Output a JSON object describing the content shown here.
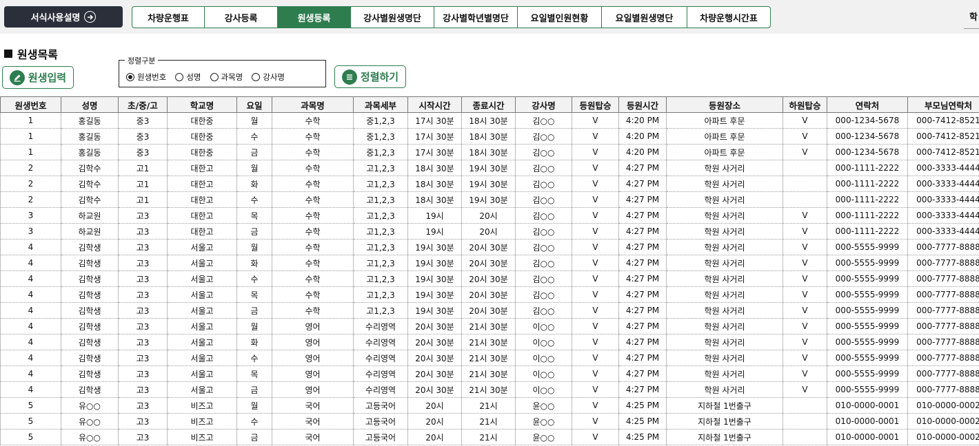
{
  "topbar": {
    "guide_label": "서식사용설명",
    "tabs": [
      {
        "label": "차량운행표",
        "width": 105
      },
      {
        "label": "강사등록",
        "width": 106
      },
      {
        "label": "원생등록",
        "width": 106,
        "active": true
      },
      {
        "label": "강사별원생명단",
        "width": 121
      },
      {
        "label": "강사별학년별명단",
        "width": 121
      },
      {
        "label": "요일별인원현황",
        "width": 122
      },
      {
        "label": "요일별원생명단",
        "width": 124
      },
      {
        "label": "차량운행시간표",
        "width": 120
      }
    ],
    "right_label": "학"
  },
  "section": {
    "title": "원생목록"
  },
  "buttons": {
    "add_label": "원생입력",
    "sort_label": "정렬하기"
  },
  "sort_group": {
    "legend": "정렬구분",
    "options": [
      {
        "label": "원생번호",
        "selected": true
      },
      {
        "label": "성명",
        "selected": false
      },
      {
        "label": "과목명",
        "selected": false
      },
      {
        "label": "강사명",
        "selected": false
      }
    ]
  },
  "table": {
    "columns": [
      {
        "label": "원생번호",
        "width": 88
      },
      {
        "label": "성명",
        "width": 83
      },
      {
        "label": "초/중/고",
        "width": 71
      },
      {
        "label": "학교명",
        "width": 101
      },
      {
        "label": "요일",
        "width": 51
      },
      {
        "label": "과목명",
        "width": 118
      },
      {
        "label": "과목세부",
        "width": 79
      },
      {
        "label": "시작시간",
        "width": 78
      },
      {
        "label": "종료시간",
        "width": 78
      },
      {
        "label": "강사명",
        "width": 82
      },
      {
        "label": "등원탑승",
        "width": 68
      },
      {
        "label": "등원시간",
        "width": 69
      },
      {
        "label": "등원장소",
        "width": 169
      },
      {
        "label": "하원탑승",
        "width": 64
      },
      {
        "label": "연락처",
        "width": 117
      },
      {
        "label": "부모님연락처",
        "width": 118
      }
    ],
    "rows": [
      [
        "1",
        "홍길동",
        "중3",
        "대한중",
        "월",
        "수학",
        "중1,2,3",
        "17시 30분",
        "18시 30분",
        "김○○",
        "V",
        "4:20 PM",
        "아파트 후문",
        "V",
        "000-1234-5678",
        "000-7412-8521"
      ],
      [
        "1",
        "홍길동",
        "중3",
        "대한중",
        "수",
        "수학",
        "중1,2,3",
        "17시 30분",
        "18시 30분",
        "김○○",
        "V",
        "4:20 PM",
        "아파트 후문",
        "V",
        "000-1234-5678",
        "000-7412-8521"
      ],
      [
        "1",
        "홍길동",
        "중3",
        "대한중",
        "금",
        "수학",
        "중1,2,3",
        "17시 30분",
        "18시 30분",
        "김○○",
        "V",
        "4:20 PM",
        "아파트 후문",
        "V",
        "000-1234-5678",
        "000-7412-8521"
      ],
      [
        "2",
        "김학수",
        "고1",
        "대한고",
        "월",
        "수학",
        "고1,2,3",
        "18시 30분",
        "19시 30분",
        "김○○",
        "V",
        "4:27 PM",
        "학원 사거리",
        "",
        "000-1111-2222",
        "000-3333-4444"
      ],
      [
        "2",
        "김학수",
        "고1",
        "대한고",
        "화",
        "수학",
        "고1,2,3",
        "18시 30분",
        "19시 30분",
        "김○○",
        "V",
        "4:27 PM",
        "학원 사거리",
        "",
        "000-1111-2222",
        "000-3333-4444"
      ],
      [
        "2",
        "김학수",
        "고1",
        "대한고",
        "수",
        "수학",
        "고1,2,3",
        "18시 30분",
        "19시 30분",
        "김○○",
        "V",
        "4:27 PM",
        "학원 사거리",
        "",
        "000-1111-2222",
        "000-3333-4444"
      ],
      [
        "3",
        "하교원",
        "고3",
        "대한고",
        "목",
        "수학",
        "고1,2,3",
        "19시",
        "20시",
        "김○○",
        "V",
        "4:27 PM",
        "학원 사거리",
        "V",
        "000-1111-2222",
        "000-3333-4444"
      ],
      [
        "3",
        "하교원",
        "고3",
        "대한고",
        "금",
        "수학",
        "고1,2,3",
        "19시",
        "20시",
        "김○○",
        "V",
        "4:27 PM",
        "학원 사거리",
        "V",
        "000-1111-2222",
        "000-3333-4444"
      ],
      [
        "4",
        "김학생",
        "고3",
        "서울고",
        "월",
        "수학",
        "고1,2,3",
        "19시 30분",
        "20시 30분",
        "김○○",
        "V",
        "4:27 PM",
        "학원 사거리",
        "V",
        "000-5555-9999",
        "000-7777-8888"
      ],
      [
        "4",
        "김학생",
        "고3",
        "서울고",
        "화",
        "수학",
        "고1,2,3",
        "19시 30분",
        "20시 30분",
        "김○○",
        "V",
        "4:27 PM",
        "학원 사거리",
        "V",
        "000-5555-9999",
        "000-7777-8888"
      ],
      [
        "4",
        "김학생",
        "고3",
        "서울고",
        "수",
        "수학",
        "고1,2,3",
        "19시 30분",
        "20시 30분",
        "김○○",
        "V",
        "4:27 PM",
        "학원 사거리",
        "V",
        "000-5555-9999",
        "000-7777-8888"
      ],
      [
        "4",
        "김학생",
        "고3",
        "서울고",
        "목",
        "수학",
        "고1,2,3",
        "19시 30분",
        "20시 30분",
        "김○○",
        "V",
        "4:27 PM",
        "학원 사거리",
        "V",
        "000-5555-9999",
        "000-7777-8888"
      ],
      [
        "4",
        "김학생",
        "고3",
        "서울고",
        "금",
        "수학",
        "고1,2,3",
        "19시 30분",
        "20시 30분",
        "김○○",
        "V",
        "4:27 PM",
        "학원 사거리",
        "V",
        "000-5555-9999",
        "000-7777-8888"
      ],
      [
        "4",
        "김학생",
        "고3",
        "서울고",
        "월",
        "영어",
        "수리영역",
        "20시 30분",
        "21시 30분",
        "이○○",
        "V",
        "4:27 PM",
        "학원 사거리",
        "V",
        "000-5555-9999",
        "000-7777-8888"
      ],
      [
        "4",
        "김학생",
        "고3",
        "서울고",
        "화",
        "영어",
        "수리영역",
        "20시 30분",
        "21시 30분",
        "이○○",
        "V",
        "4:27 PM",
        "학원 사거리",
        "V",
        "000-5555-9999",
        "000-7777-8888"
      ],
      [
        "4",
        "김학생",
        "고3",
        "서울고",
        "수",
        "영어",
        "수리영역",
        "20시 30분",
        "21시 30분",
        "이○○",
        "V",
        "4:27 PM",
        "학원 사거리",
        "V",
        "000-5555-9999",
        "000-7777-8888"
      ],
      [
        "4",
        "김학생",
        "고3",
        "서울고",
        "목",
        "영어",
        "수리영역",
        "20시 30분",
        "21시 30분",
        "이○○",
        "V",
        "4:27 PM",
        "학원 사거리",
        "V",
        "000-5555-9999",
        "000-7777-8888"
      ],
      [
        "4",
        "김학생",
        "고3",
        "서울고",
        "금",
        "영어",
        "수리영역",
        "20시 30분",
        "21시 30분",
        "이○○",
        "V",
        "4:27 PM",
        "학원 사거리",
        "V",
        "000-5555-9999",
        "000-7777-8888"
      ],
      [
        "5",
        "유○○",
        "고3",
        "비즈고",
        "월",
        "국어",
        "고등국어",
        "20시",
        "21시",
        "윤○○",
        "V",
        "4:25 PM",
        "지하철 1번출구",
        "",
        "010-0000-0001",
        "010-0000-0002"
      ],
      [
        "5",
        "유○○",
        "고3",
        "비즈고",
        "수",
        "국어",
        "고등국어",
        "20시",
        "21시",
        "윤○○",
        "V",
        "4:25 PM",
        "지하철 1번출구",
        "",
        "010-0000-0001",
        "010-0000-0002"
      ],
      [
        "5",
        "유○○",
        "고3",
        "비즈고",
        "금",
        "국어",
        "고등국어",
        "20시",
        "21시",
        "윤○○",
        "V",
        "4:25 PM",
        "지하철 1번출구",
        "",
        "010-0000-0001",
        "010-0000-0002"
      ]
    ]
  }
}
